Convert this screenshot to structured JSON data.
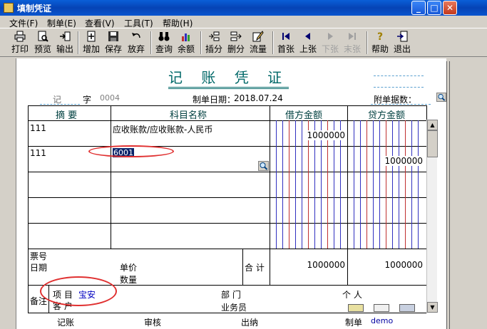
{
  "window": {
    "title": "填制凭证",
    "minimize": "_",
    "maximize": "□",
    "close": "✕"
  },
  "menu": [
    "文件(F)",
    "制单(E)",
    "查看(V)",
    "工具(T)",
    "帮助(H)"
  ],
  "toolbar": [
    {
      "label": "打印",
      "icon": "printer-icon",
      "enabled": true
    },
    {
      "label": "预览",
      "icon": "preview-icon",
      "enabled": true
    },
    {
      "label": "输出",
      "icon": "export-icon",
      "enabled": true
    },
    {
      "label": "增加",
      "icon": "add-icon",
      "enabled": true
    },
    {
      "label": "保存",
      "icon": "save-icon",
      "enabled": true
    },
    {
      "label": "放弃",
      "icon": "undo-icon",
      "enabled": true
    },
    {
      "label": "查询",
      "icon": "binoculars-icon",
      "enabled": true
    },
    {
      "label": "余额",
      "icon": "balance-chart-icon",
      "enabled": true
    },
    {
      "label": "插分",
      "icon": "insert-row-icon",
      "enabled": true
    },
    {
      "label": "删分",
      "icon": "delete-row-icon",
      "enabled": true
    },
    {
      "label": "流量",
      "icon": "cashflow-icon",
      "enabled": true
    },
    {
      "label": "首张",
      "icon": "first-icon",
      "enabled": true
    },
    {
      "label": "上张",
      "icon": "prev-icon",
      "enabled": true
    },
    {
      "label": "下张",
      "icon": "next-icon",
      "enabled": false
    },
    {
      "label": "末张",
      "icon": "last-icon",
      "enabled": false
    },
    {
      "label": "帮助",
      "icon": "help-icon",
      "enabled": true
    },
    {
      "label": "退出",
      "icon": "exit-icon",
      "enabled": true
    }
  ],
  "voucher": {
    "title": "记 账 凭 证",
    "type": "记",
    "word_label": "字",
    "number": "0004",
    "date_label": "制单日期：",
    "date": "2018.07.24",
    "attach_label": "附单据数：",
    "headers": {
      "summary": "摘 要",
      "account": "科目名称",
      "debit": "借方金额",
      "credit": "贷方金额"
    },
    "rows": [
      {
        "summary": "111",
        "account": "应收账款/应收账款-人民币",
        "debit": "1000000",
        "credit": ""
      },
      {
        "summary": "111",
        "account": "6001",
        "debit": "",
        "credit": "1000000"
      }
    ],
    "ticket_label": "票号",
    "date_row_label": "日期",
    "price_label": "单价",
    "qty_label": "数量",
    "total_label": "合 计",
    "total_debit": "1000000",
    "total_credit": "1000000",
    "remark_label": "备注",
    "project_label": "项 目",
    "project_value": "宝安",
    "customer_label": "客 户",
    "dept_label": "部 门",
    "person_label": "个 人",
    "clerk_label": "业务员",
    "footer": {
      "bookkeeper": "记账",
      "auditor": "审核",
      "cashier": "出纳",
      "maker_label": "制单",
      "maker": "demo"
    }
  },
  "colors": {
    "title_teal": "#006868",
    "annotation_red": "#e03030",
    "selection_blue": "#0a246a"
  }
}
